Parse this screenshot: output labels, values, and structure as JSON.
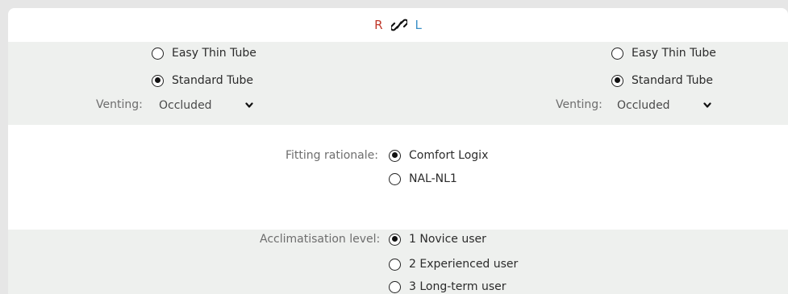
{
  "header": {
    "right_label": "R",
    "left_label": "L",
    "link_icon": "link-icon"
  },
  "right_ear": {
    "tubes": [
      {
        "label": "Easy Thin Tube",
        "checked": false
      },
      {
        "label": "Standard Tube",
        "checked": true
      }
    ],
    "venting_label": "Venting:",
    "venting_value": "Occluded"
  },
  "left_ear": {
    "tubes": [
      {
        "label": "Easy Thin Tube",
        "checked": false
      },
      {
        "label": "Standard Tube",
        "checked": true
      }
    ],
    "venting_label": "Venting:",
    "venting_value": "Occluded"
  },
  "fitting": {
    "label": "Fitting rationale:",
    "options": [
      {
        "label": "Comfort Logix",
        "checked": true
      },
      {
        "label": "NAL-NL1",
        "checked": false
      }
    ]
  },
  "acclimatisation": {
    "label": "Acclimatisation level:",
    "options": [
      {
        "label": "1 Novice user",
        "checked": true
      },
      {
        "label": "2 Experienced user",
        "checked": false
      },
      {
        "label": "3 Long-term user",
        "checked": false
      }
    ]
  }
}
